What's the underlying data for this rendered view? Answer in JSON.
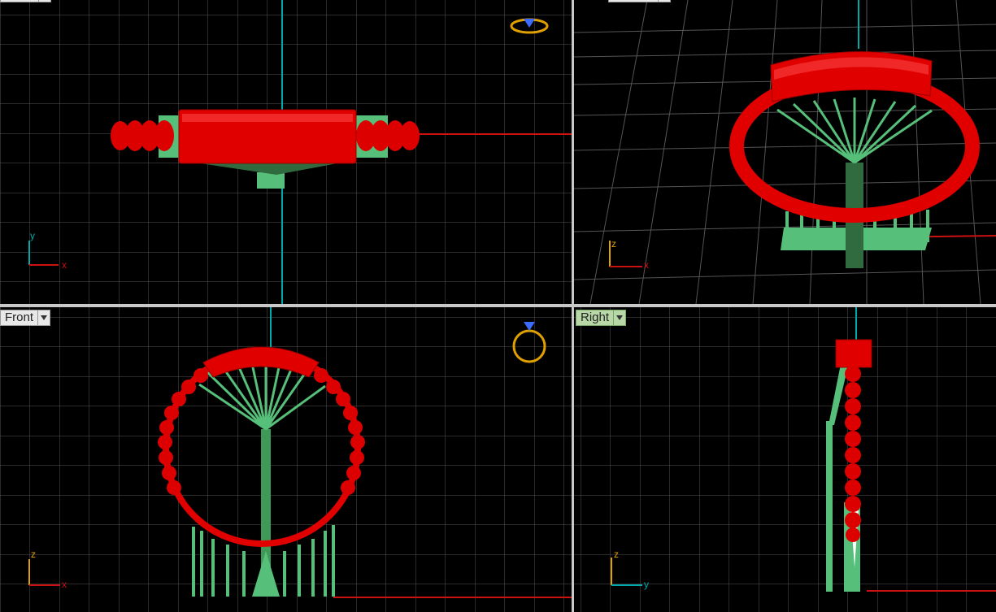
{
  "viewports": {
    "top": {
      "label": ""
    },
    "perspective": {
      "label": ""
    },
    "front": {
      "label": "Front"
    },
    "right": {
      "label": "Right"
    }
  },
  "axes": {
    "top": [
      "x",
      "y"
    ],
    "perspective": [
      "x",
      "z"
    ],
    "front": [
      "x",
      "z"
    ],
    "right": [
      "y",
      "z"
    ]
  },
  "colors": {
    "grid": "#5a5a5a",
    "grid_major": "#8a8a8a",
    "axis_x": "#cc1111",
    "axis_y": "#00a0a0",
    "model": "#e00000",
    "supports": "#56c07a",
    "active_label": "#b9d8a8"
  },
  "icons": [
    "ring-orientation-icon"
  ]
}
